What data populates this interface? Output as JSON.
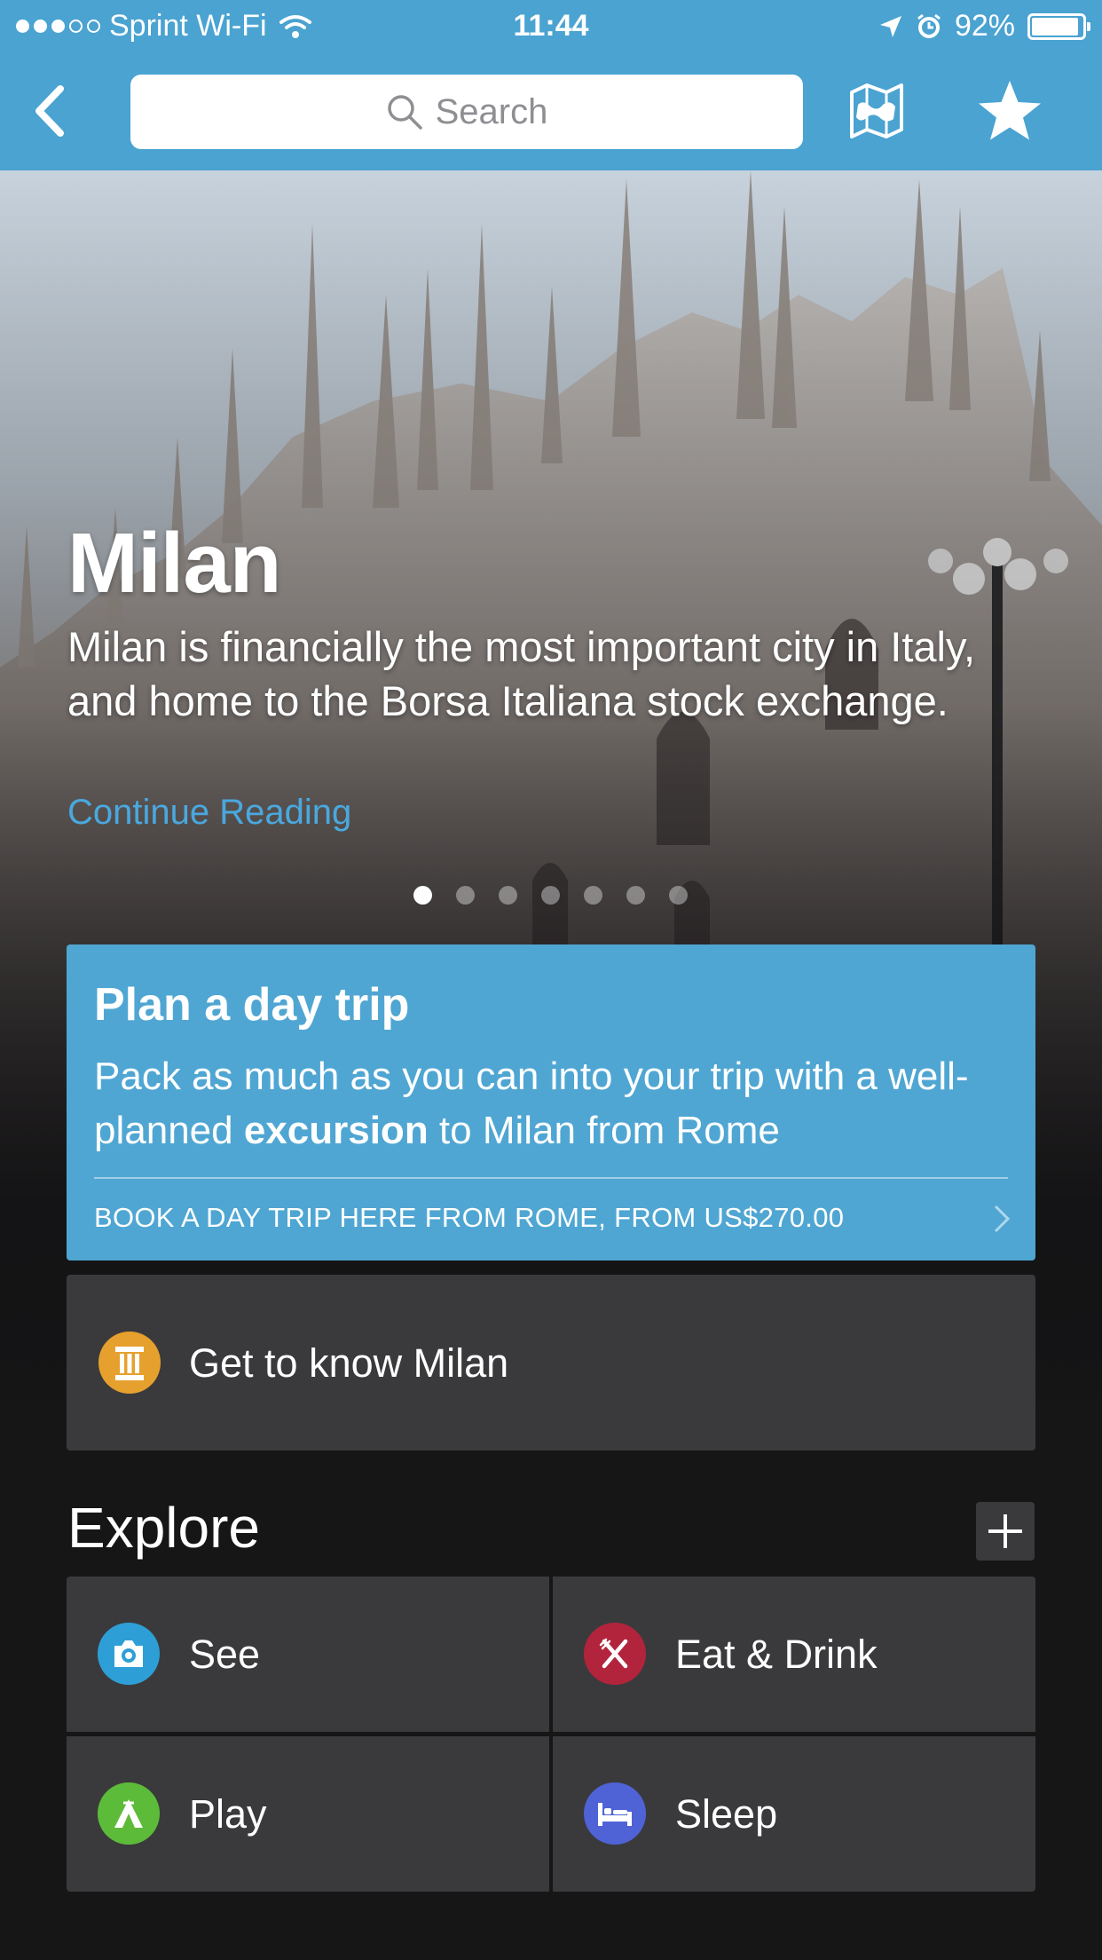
{
  "status_bar": {
    "signal_bars_filled": 3,
    "signal_bars_total": 5,
    "carrier": "Sprint Wi-Fi",
    "time": "11:44",
    "battery_percent": "92%",
    "battery_level": 0.92
  },
  "nav": {
    "search_placeholder": "Search",
    "back_icon": "chevron-left-icon",
    "map_icon": "map-icon",
    "favorite_icon": "star-icon"
  },
  "hero": {
    "title": "Milan",
    "description": "Milan is financially the most important city in Italy, and home to the Borsa Italiana stock exchange.",
    "continue_label": "Continue Reading",
    "page_count": 7,
    "active_page": 0
  },
  "trip_card": {
    "title": "Plan a day trip",
    "body_before": "Pack as much as you can into your trip with a well-planned ",
    "body_bold": "excursion",
    "body_after": " to Milan from Rome",
    "cta": "BOOK A DAY TRIP HERE FROM ROME, FROM US$270.00"
  },
  "know_card": {
    "label": "Get to know Milan",
    "icon": "pillar-icon"
  },
  "explore": {
    "title": "Explore",
    "add_icon": "plus-icon",
    "tiles": [
      {
        "label": "See",
        "icon": "camera-icon",
        "color": "#2e9fd6"
      },
      {
        "label": "Eat & Drink",
        "icon": "fork-knife-icon",
        "color": "#b2243c"
      },
      {
        "label": "Play",
        "icon": "tent-icon",
        "color": "#5dbb3a"
      },
      {
        "label": "Sleep",
        "icon": "bed-icon",
        "color": "#4f63d6"
      }
    ]
  },
  "colors": {
    "brand_blue": "#4aa3d1",
    "link_blue": "#4aa8df",
    "trip_card_blue": "#4fa6d3",
    "pillar_orange": "#e6a02e"
  }
}
